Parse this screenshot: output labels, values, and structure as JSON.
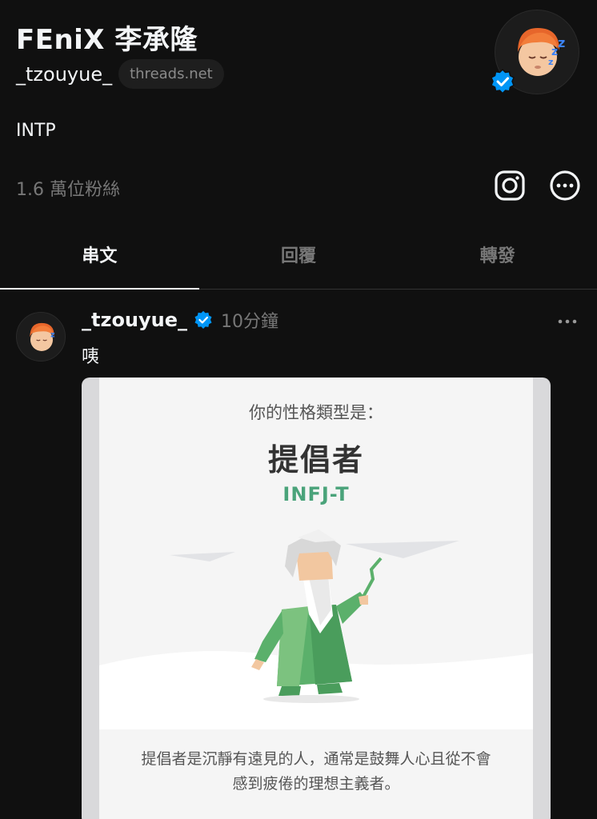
{
  "profile": {
    "display_name": "FEniX 李承隆",
    "handle": "_tzouyue_",
    "domain": "threads.net",
    "bio": "INTP",
    "followers": "1.6 萬位粉絲"
  },
  "tabs": [
    {
      "label": "串文",
      "active": true
    },
    {
      "label": "回覆",
      "active": false
    },
    {
      "label": "轉發",
      "active": false
    }
  ],
  "post": {
    "username": "_tzouyue_",
    "time": "10分鐘",
    "text": "咦",
    "card": {
      "intro": "你的性格類型是：",
      "type": "提倡者",
      "code": "INFJ-T",
      "desc_line1": "提倡者是沉靜有遠見的人，通常是鼓舞人心且從不會",
      "desc_line2": "感到疲倦的理想主義者。"
    }
  },
  "colors": {
    "background": "#101010",
    "verified": "#0095f6",
    "code_green": "#4aa37a"
  },
  "icons": [
    "verified-badge-icon",
    "instagram-icon",
    "more-circle-icon",
    "more-horizontal-icon"
  ]
}
